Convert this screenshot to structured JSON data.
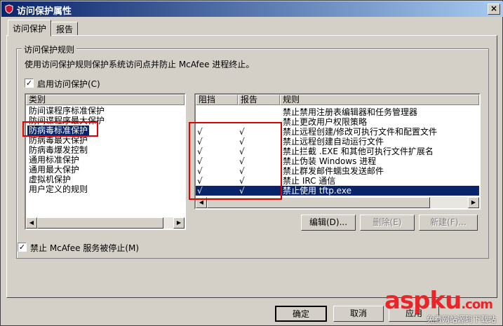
{
  "window": {
    "title": "访问保护属性",
    "close_glyph": "×"
  },
  "tabs": [
    {
      "label": "访问保护"
    },
    {
      "label": "报告"
    }
  ],
  "group": {
    "title": "访问保护规则",
    "description": "使用访问保护规则保护系统访问点并防止 McAfee 进程终止。"
  },
  "enable_access_protection": {
    "label": "启用访问保护(C)",
    "checked": true,
    "glyph": "✓"
  },
  "category_list": {
    "header": "类别",
    "items": [
      "防间谍程序标准保护",
      "防间谍程序最大保护",
      "防病毒标准保护",
      "防病毒最大保护",
      "防病毒爆发控制",
      "通用标准保护",
      "通用最大保护",
      "虚拟机保护",
      "用户定义的规则"
    ],
    "selected_index": 2
  },
  "rules_table": {
    "columns": [
      "阻挡",
      "报告",
      "规则"
    ],
    "rows": [
      {
        "block": "",
        "report": "",
        "rule": "禁止禁用注册表编辑器和任务管理器"
      },
      {
        "block": "",
        "report": "",
        "rule": "禁止更改用户权限策略"
      },
      {
        "block": "√",
        "report": "√",
        "rule": "禁止远程创建/修改可执行文件和配置文件"
      },
      {
        "block": "√",
        "report": "√",
        "rule": "禁止远程创建自动运行文件"
      },
      {
        "block": "√",
        "report": "√",
        "rule": "禁止拦截 .EXE 和其他可执行文件扩展名"
      },
      {
        "block": "√",
        "report": "√",
        "rule": "禁止伪装 Windows 进程"
      },
      {
        "block": "√",
        "report": "√",
        "rule": "禁止群发邮件蠕虫发送邮件"
      },
      {
        "block": "√",
        "report": "√",
        "rule": "禁止 IRC 通信"
      },
      {
        "block": "√",
        "report": "√",
        "rule": "禁止使用 tftp.exe"
      }
    ],
    "selected_index": 8
  },
  "rule_buttons": {
    "edit": "编辑(D)...",
    "delete": "删除(E)",
    "new": "新建(F)..."
  },
  "prevent_stop": {
    "label": "禁止 McAfee 服务被停止(M)",
    "checked": true,
    "glyph": "✓"
  },
  "dialog_buttons": {
    "ok": "确定",
    "cancel": "取消",
    "apply": "应用"
  },
  "scroll_glyphs": {
    "left": "◀",
    "right": "▶"
  },
  "watermark": {
    "brand": "aspku",
    "domain": ".com",
    "subtitle": "免费网站源码下载站"
  },
  "colors": {
    "accent": "#0a246a",
    "highlight": "#e00000",
    "watermark_red": "#e8262a"
  }
}
